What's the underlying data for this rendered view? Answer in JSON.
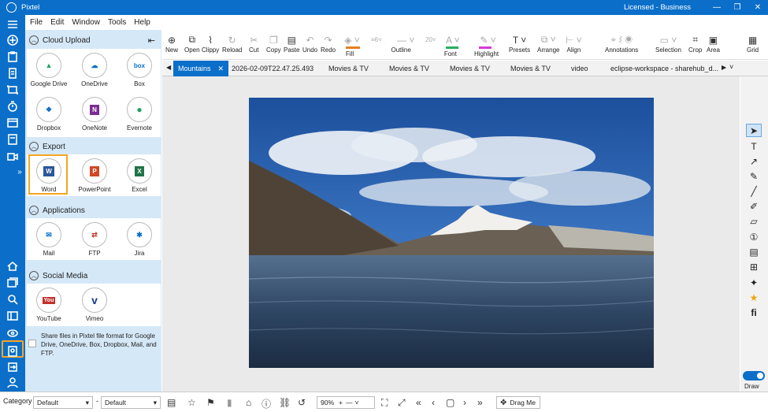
{
  "window": {
    "title": "Pixtel",
    "license": "Licensed - Business"
  },
  "menu": [
    "File",
    "Edit",
    "Window",
    "Tools",
    "Help"
  ],
  "panel": {
    "cloud_upload": {
      "title": "Cloud Upload",
      "items": [
        "Google Drive",
        "OneDrive",
        "Box",
        "Dropbox",
        "OneNote",
        "Evernote"
      ]
    },
    "export": {
      "title": "Export",
      "items": [
        "Word",
        "PowerPoint",
        "Excel"
      ]
    },
    "applications": {
      "title": "Applications",
      "items": [
        "Mail",
        "FTP",
        "Jira"
      ]
    },
    "social_media": {
      "title": "Social Media",
      "items": [
        "YouTube",
        "Vimeo"
      ]
    },
    "share_text": "Share files in Pixtel file format for Google Drive, OneDrive, Box, Dropbox, Mail, and FTP."
  },
  "toolbar": {
    "new": "New",
    "open": "Open",
    "clippy": "Clippy",
    "reload": "Reload",
    "cut": "Cut",
    "copy": "Copy",
    "paste": "Paste",
    "undo": "Undo",
    "redo": "Redo",
    "fill": "Fill",
    "outline": "Outline",
    "font": "Font",
    "highlight": "Highlight",
    "presets": "Presets",
    "arrange": "Arrange",
    "align": "Align",
    "annotations": "Annotations",
    "selection": "Selection",
    "crop": "Crop",
    "area": "Area",
    "grid": "Grid",
    "outline_width": "6",
    "font_size": "20"
  },
  "tabs": [
    "Mountains",
    "2026-02-09T22.47.25.493",
    "Movies & TV",
    "Movies & TV",
    "Movies & TV",
    "Movies & TV",
    "video",
    "eclipse-workspace - sharehub_d..."
  ],
  "right_tools": {
    "draw_label": "Draw"
  },
  "status": {
    "category_label": "Category",
    "category_value": "Default",
    "second_value": "Default",
    "zoom": "90%",
    "drag_me": "Drag Me"
  },
  "colors": {
    "brand": "#0b6fc9",
    "panel": "#d5e8f8",
    "highlight": "#f5a623"
  }
}
